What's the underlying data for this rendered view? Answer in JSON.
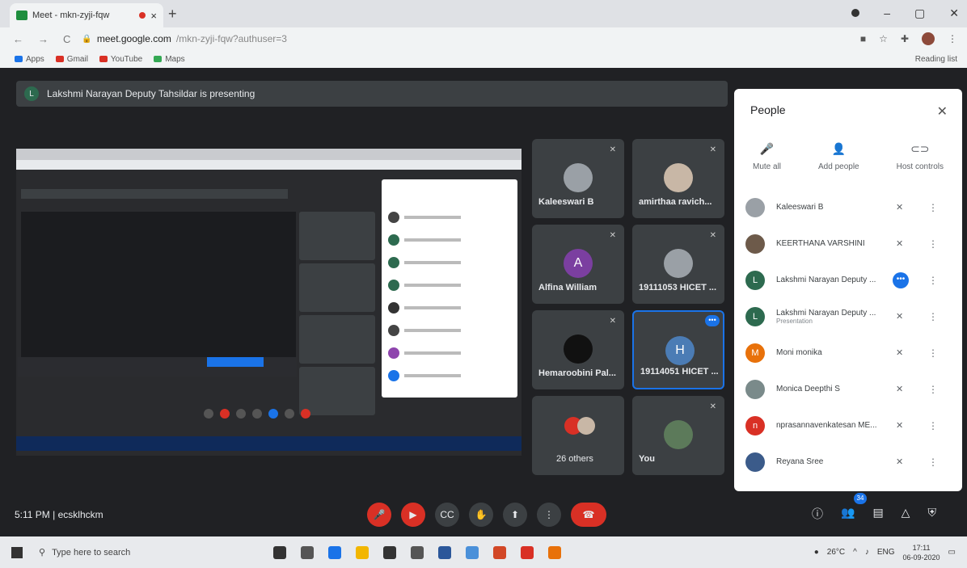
{
  "browser": {
    "tab_title": "Meet - mkn-zyji-fqw",
    "url_host": "meet.google.com",
    "url_path": "/mkn-zyji-fqw?authuser=3",
    "bookmarks": [
      "Apps",
      "Gmail",
      "YouTube",
      "Maps"
    ],
    "reading_list": "Reading list"
  },
  "presenting": {
    "avatar": "L",
    "text": "Lakshmi Narayan Deputy Tahsildar is presenting"
  },
  "tiles": [
    {
      "name": "Kaleeswari B"
    },
    {
      "name": "amirthaa ravich..."
    },
    {
      "name": "Alfina William",
      "avatar": "A"
    },
    {
      "name": "19111053 HICET ..."
    },
    {
      "name": "Hemaroobini Pal..."
    },
    {
      "name": "19114051 HICET ...",
      "avatar": "H"
    },
    {
      "name": "26 others"
    },
    {
      "name": "You"
    }
  ],
  "people": {
    "title": "People",
    "actions": [
      "Mute all",
      "Add people",
      "Host controls"
    ],
    "list": [
      {
        "name": "Kaleeswari B",
        "sub": ""
      },
      {
        "name": "KEERTHANA VARSHINI",
        "sub": ""
      },
      {
        "name": "Lakshmi Narayan Deputy ...",
        "sub": "",
        "avatar": "L"
      },
      {
        "name": "Lakshmi Narayan Deputy ...",
        "sub": "Presentation",
        "avatar": "L"
      },
      {
        "name": "Moni monika",
        "sub": "",
        "avatar": "M"
      },
      {
        "name": "Monica Deepthi S",
        "sub": ""
      },
      {
        "name": "nprasannavenkatesan ME...",
        "sub": "",
        "avatar": "n"
      },
      {
        "name": "Reyana Sree",
        "sub": ""
      }
    ]
  },
  "bottom": {
    "time": "5:11 PM",
    "separator": "|",
    "code": "ecsklhckm",
    "people_count": "34"
  },
  "taskbar": {
    "search_placeholder": "Type here to search",
    "weather": "26°C",
    "lang": "ENG",
    "clock_time": "17:11",
    "clock_date": "06-09-2020"
  },
  "colors": {
    "accent": "#1a73e8",
    "danger": "#d93025"
  }
}
